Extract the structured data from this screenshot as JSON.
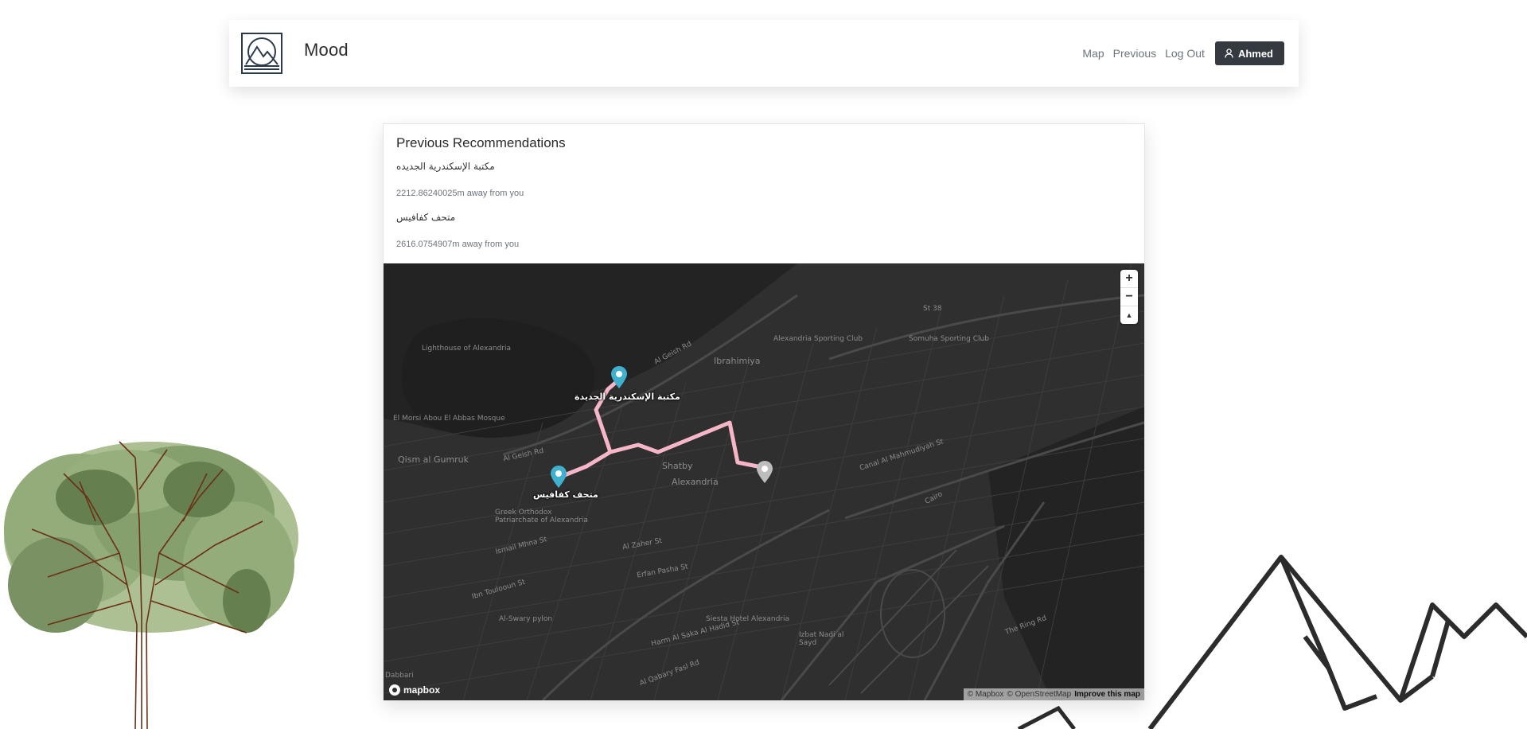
{
  "app": {
    "brand": "Mood"
  },
  "nav": {
    "links": [
      "Map",
      "Previous",
      "Log Out"
    ],
    "user": "Ahmed"
  },
  "card": {
    "title": "Previous Recommendations",
    "recommendations": [
      {
        "name": "مكتبة الإسكندرية الجديده",
        "distance": "2212.86240025m away from you"
      },
      {
        "name": "متحف كفافيس",
        "distance": "2616.0754907m away from you"
      }
    ]
  },
  "map": {
    "labels": [
      "Lighthouse of Alexandria",
      "Al Geish Rd",
      "Ibrahimiya",
      "Alexandria Sporting Club",
      "Somuha Sporting Club",
      "El Morsi Abou El Abbas Mosque",
      "Qism al Gumruk",
      "Al Geish Rd",
      "Shatby",
      "Alexandria",
      "Greek Orthodox Patriarchate of Alexandria",
      "Ismail Mhna St",
      "Al Zaher St",
      "Erfan Pasha St",
      "Ibn Toulooun St",
      "Al-Swary pylon",
      "Siesta Hotel Alexandria",
      "Izbat Nadi al Sayd",
      "Al Qabary Fasl Rd",
      "Canal Al Mahmudiyah St",
      "The Ring Rd",
      "Cairo",
      "Dabbari",
      "St 38",
      "Harm Al Saka Al Hadid St"
    ],
    "poi": [
      "مكتبة الإسكندرية الجديدة",
      "متحف كفافيس"
    ],
    "zoom_in": "+",
    "zoom_out": "−",
    "compass": "▲",
    "logo": "mapbox",
    "attribution": [
      "© Mapbox",
      "© OpenStreetMap",
      "Improve this map"
    ],
    "route_color": "#f7b6c8",
    "marker_color": "#3fb1ce"
  }
}
